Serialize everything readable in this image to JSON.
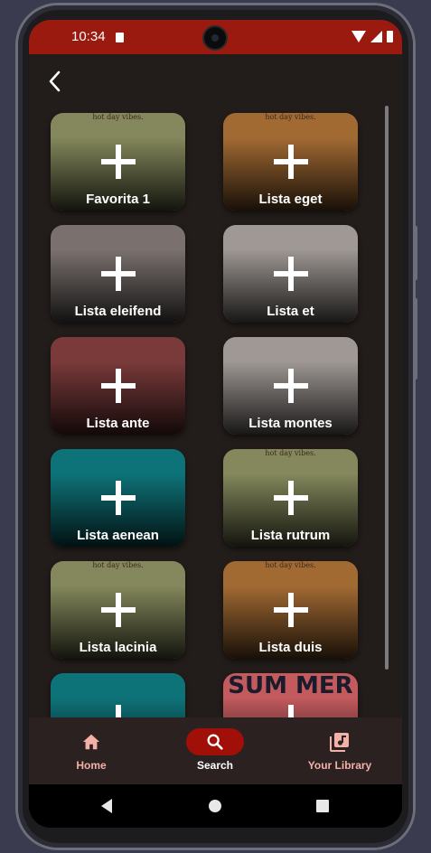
{
  "status_bar": {
    "time": "10:34"
  },
  "tiles": [
    {
      "label": "Favorita 1",
      "art": "green",
      "tiny": "hot day vibes."
    },
    {
      "label": "Lista eget",
      "art": "orange",
      "tiny": "hot day vibes."
    },
    {
      "label": "Lista eleifend",
      "art": "gray",
      "tiny": ""
    },
    {
      "label": "Lista et",
      "art": "gray2",
      "tiny": ""
    },
    {
      "label": "Lista ante",
      "art": "red",
      "tiny": ""
    },
    {
      "label": "Lista montes",
      "art": "gray2",
      "tiny": ""
    },
    {
      "label": "Lista aenean",
      "art": "teal",
      "tiny": ""
    },
    {
      "label": "Lista rutrum",
      "art": "green",
      "tiny": "hot day vibes."
    },
    {
      "label": "Lista lacinia",
      "art": "green",
      "tiny": "hot day vibes."
    },
    {
      "label": "Lista duis",
      "art": "orange",
      "tiny": "hot day vibes."
    },
    {
      "label": "",
      "art": "teal",
      "tiny": ""
    },
    {
      "label": "",
      "art": "pink",
      "tiny": "SUM MER"
    }
  ],
  "bottom_nav": {
    "home": "Home",
    "search": "Search",
    "library": "Your Library"
  },
  "colors": {
    "status_bar": "#9b1a10",
    "background": "#221c1a",
    "nav_active": "#a01008",
    "nav_inactive_text": "#f3b0a7"
  }
}
